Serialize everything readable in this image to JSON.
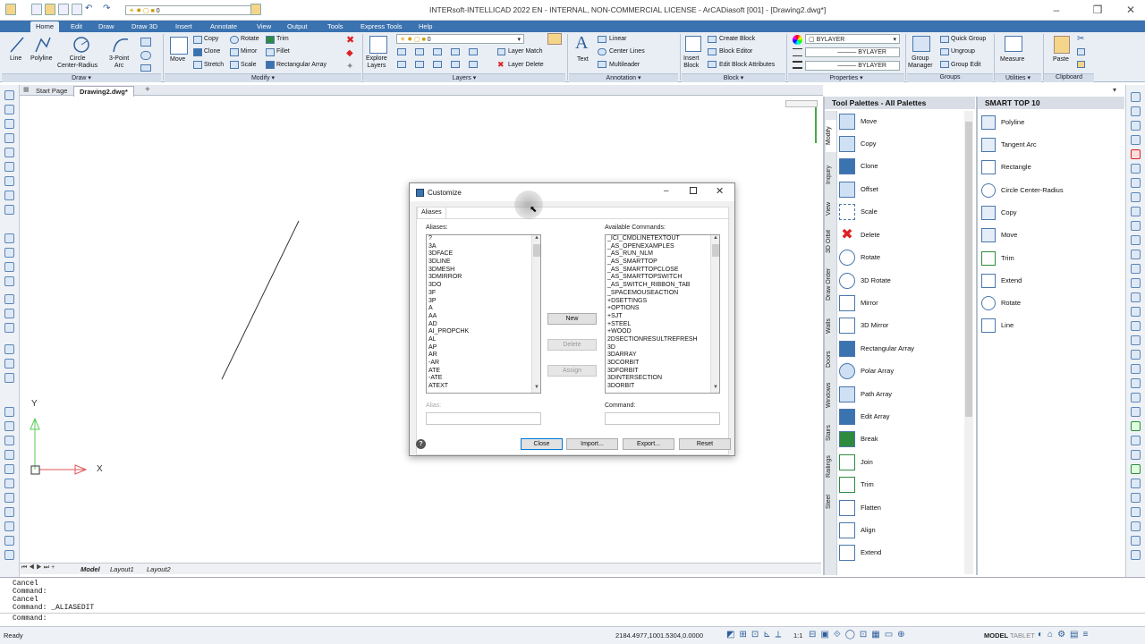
{
  "window": {
    "title": "INTERsoft-INTELLICAD 2022 EN - INTERNAL, NON-COMMERCIAL LICENSE - ArCADiasoft [001] - [Drawing2.dwg*]",
    "layer_value": "0",
    "minimize": "–",
    "maximize": "❒",
    "close": "✕"
  },
  "ribbon_tabs": [
    "Home",
    "Edit",
    "Draw",
    "Draw 3D",
    "Insert",
    "Annotate",
    "View",
    "Output",
    "Tools",
    "Express Tools",
    "Help"
  ],
  "ribbon": {
    "draw": {
      "line": "Line",
      "polyline": "Polyline",
      "circle": "Circle\nCenter-Radius",
      "arc": "3-Point\nArc",
      "label": "Draw ▾"
    },
    "modify": {
      "move": "Move",
      "copy": "Copy",
      "rotate": "Rotate",
      "trim": "Trim",
      "clone": "Clone",
      "mirror": "Mirror",
      "fillet": "Fillet",
      "stretch": "Stretch",
      "scale": "Scale",
      "rect_array": "Rectangular Array",
      "label": "Modify ▾"
    },
    "layers": {
      "explore": "Explore\nLayers",
      "layer_value": "0",
      "layer_match": "Layer Match",
      "layer_delete": "Layer Delete",
      "label": "Layers ▾"
    },
    "annotation": {
      "text": "Text",
      "linear": "Linear",
      "center_lines": "Center Lines",
      "multileader": "Multileader",
      "label": "Annotation ▾"
    },
    "block": {
      "insert": "Insert\nBlock",
      "create": "Create Block",
      "editor": "Block Editor",
      "edit_attr": "Edit Block Attributes",
      "label": "Block ▾"
    },
    "properties": {
      "color": "BYLAYER",
      "linetype": "BYLAYER",
      "lineweight": "BYLAYER",
      "label": "Properties ▾"
    },
    "groups": {
      "manager": "Group\nManager",
      "quick": "Quick Group",
      "ungroup": "Ungroup",
      "edit": "Group Edit",
      "label": "Groups"
    },
    "utilities": {
      "measure": "Measure",
      "label": "Utilities ▾"
    },
    "clipboard": {
      "paste": "Paste",
      "label": "Clipboard"
    }
  },
  "doc_tabs": [
    "Start Page",
    "Drawing2.dwg*"
  ],
  "layout_tabs": [
    "Model",
    "Layout1",
    "Layout2"
  ],
  "axis": {
    "x": "X",
    "y": "Y"
  },
  "tool_palette": {
    "title": "Tool Palettes - All Palettes",
    "side_tabs": [
      "Modify",
      "Inquiry",
      "View",
      "3D Orbit",
      "Draw Order",
      "Walls",
      "Doors",
      "Windows",
      "Stairs",
      "Railings",
      "Steel"
    ],
    "items": [
      "Move",
      "Copy",
      "Clone",
      "Offset",
      "Scale",
      "Delete",
      "Rotate",
      "3D Rotate",
      "Mirror",
      "3D Mirror",
      "Rectangular Array",
      "Polar Array",
      "Path Array",
      "Edit Array",
      "Break",
      "Join",
      "Trim",
      "Flatten",
      "Align",
      "Extend"
    ]
  },
  "smart_top": {
    "title": "SMART TOP 10",
    "items": [
      "Polyline",
      "Tangent Arc",
      "Rectangle",
      "Circle Center-Radius",
      "Copy",
      "Move",
      "Trim",
      "Extend",
      "Rotate",
      "Line"
    ]
  },
  "dialog": {
    "title": "Customize",
    "tab": "Aliases",
    "aliases_label": "Aliases:",
    "aliases": [
      "?",
      "3A",
      "3DFACE",
      "3DLINE",
      "3DMESH",
      "3DMIRROR",
      "3DO",
      "3F",
      "3P",
      "A",
      "AA",
      "AD",
      "AI_PROPCHK",
      "AL",
      "AP",
      "AR",
      "-AR",
      "ATE",
      "-ATE",
      "ATEXT"
    ],
    "commands_label": "Available Commands:",
    "commands": [
      "_ICI_CMDLINETEXTOUT",
      "_AS_OPENEXAMPLES",
      "_AS_RUN_NLM",
      "_AS_SMARTTOP",
      "_AS_SMARTTOPCLOSE",
      "_AS_SMARTTOPSWITCH",
      "_AS_SWITCH_RIBBON_TAB",
      "_SPACEMOUSEACTION",
      "+DSETTINGS",
      "+OPTIONS",
      "+SJT",
      "+STEEL",
      "+WOOD",
      "2DSECTIONRESULTREFRESH",
      "3D",
      "3DARRAY",
      "3DCORBIT",
      "3DFORBIT",
      "3DINTERSECTION",
      "3DORBIT"
    ],
    "new": "New",
    "delete": "Delete",
    "assign": "Assign",
    "alias_label": "Alias:",
    "command_label": "Command:",
    "close": "Close",
    "import": "Import...",
    "export": "Export...",
    "reset": "Reset",
    "help": "?"
  },
  "command_history": [
    "Cancel",
    "Command:",
    "Cancel",
    "Command: _ALIASEDIT"
  ],
  "command_prompt": "Command:",
  "status": {
    "ready": "Ready",
    "coords": "2184.4977,1001.5304,0.0000",
    "scale": "1:1",
    "model": "MODEL",
    "tablet": "TABLET"
  }
}
